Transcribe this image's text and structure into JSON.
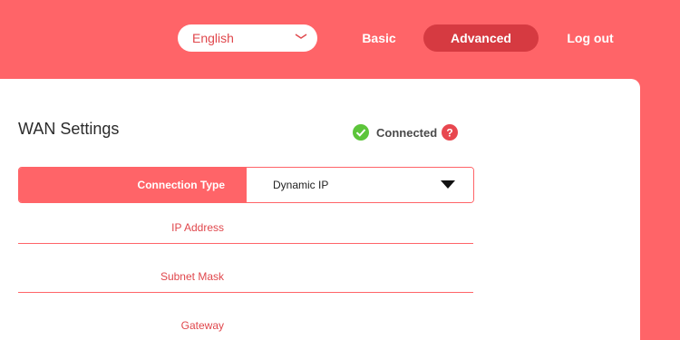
{
  "header": {
    "language": {
      "value": "English",
      "icon": "chevron-down-icon"
    },
    "nav": {
      "basic_label": "Basic",
      "advanced_label": "Advanced",
      "logout_label": "Log out",
      "active": "Advanced"
    }
  },
  "wan": {
    "title": "WAN Settings",
    "status_text": "Connected",
    "status_icon": "check-circle-icon",
    "help_icon": "help-icon",
    "connection_type": {
      "label": "Connection Type",
      "value": "Dynamic IP",
      "icon": "dropdown-arrow-icon"
    },
    "fields": {
      "ip_address_label": "IP Address",
      "subnet_mask_label": "Subnet Mask",
      "gateway_label": "Gateway"
    }
  },
  "colors": {
    "brand": "#ff6468",
    "active_nav": "#d63a41",
    "status_ok": "#5cc53a",
    "label_text": "#e0474c"
  }
}
